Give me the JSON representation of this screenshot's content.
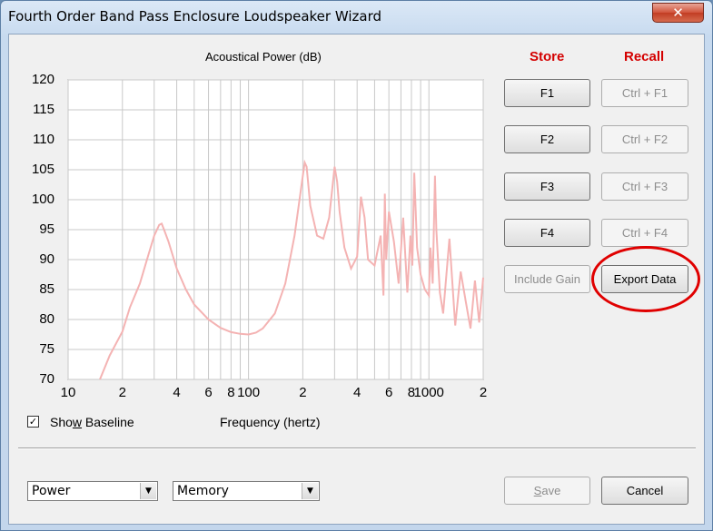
{
  "window": {
    "title": "Fourth Order Band Pass Enclosure Loudspeaker Wizard",
    "close_glyph": "✕"
  },
  "chart": {
    "title": "Acoustical Power (dB)",
    "xlabel": "Frequency (hertz)",
    "series_color": "#f4b3b3",
    "y_ticks": [
      "120",
      "115",
      "110",
      "105",
      "100",
      "95",
      "90",
      "85",
      "80",
      "75",
      "70"
    ],
    "x_ticks": [
      "10",
      "2",
      "4",
      "6",
      "8",
      "100",
      "2",
      "4",
      "6",
      "8",
      "1000",
      "2"
    ]
  },
  "chart_data": {
    "type": "line",
    "title": "Acoustical Power (dB)",
    "xlabel": "Frequency (hertz)",
    "ylabel": "",
    "x_scale": "log",
    "xlim": [
      10,
      2000
    ],
    "ylim": [
      70,
      120
    ],
    "grid": true,
    "series": [
      {
        "x": [
          15,
          17,
          20,
          22,
          25,
          28,
          30,
          32,
          33,
          34,
          36,
          40,
          45,
          50,
          60,
          70,
          80,
          90,
          100,
          110,
          120,
          140,
          160,
          180,
          200,
          205,
          210,
          220,
          240,
          260,
          280,
          300,
          310,
          320,
          340,
          370,
          400,
          420,
          440,
          460,
          500,
          540,
          560,
          570,
          580,
          600,
          640,
          680,
          720,
          760,
          790,
          810,
          830,
          860,
          900,
          950,
          1000,
          1020,
          1050,
          1080,
          1100,
          1150,
          1200,
          1300,
          1400,
          1500,
          1600,
          1700,
          1800,
          1900,
          2000
        ],
        "values": [
          70,
          74,
          78,
          82,
          86,
          91,
          94,
          95.8,
          96,
          95,
          93,
          88.5,
          85,
          82.5,
          80,
          78.6,
          77.9,
          77.6,
          77.5,
          77.8,
          78.5,
          81,
          86,
          94,
          104,
          106.2,
          105.5,
          99,
          94,
          93.5,
          97,
          105.5,
          103,
          98,
          92,
          88.5,
          90.5,
          100.5,
          97,
          90,
          89,
          94,
          84,
          101,
          90,
          98,
          93,
          86,
          97,
          84.5,
          94,
          89,
          104.5,
          92,
          87.5,
          85,
          84,
          92,
          86,
          104,
          95,
          84.5,
          81,
          93.5,
          79,
          88,
          83,
          78.5,
          86.5,
          79.5,
          87
        ]
      }
    ]
  },
  "store": {
    "label": "Store",
    "buttons": [
      "F1",
      "F2",
      "F3",
      "F4"
    ]
  },
  "recall": {
    "label": "Recall",
    "buttons": [
      "Ctrl + F1",
      "Ctrl + F2",
      "Ctrl + F3",
      "Ctrl + F4"
    ]
  },
  "include_gain_label": "Include Gain",
  "export_data_label": "Export Data",
  "baseline": {
    "label_pre": "Sho",
    "label_accel": "w",
    "label_post": " Baseline",
    "checked": true,
    "check_glyph": "✓"
  },
  "combos": {
    "mode_value": "Power",
    "source_value": "Memory",
    "arrow_glyph": "▼"
  },
  "footer": {
    "save_accel": "S",
    "save_rest": "ave",
    "cancel_label": "Cancel"
  },
  "annotation_color": "#e00000"
}
